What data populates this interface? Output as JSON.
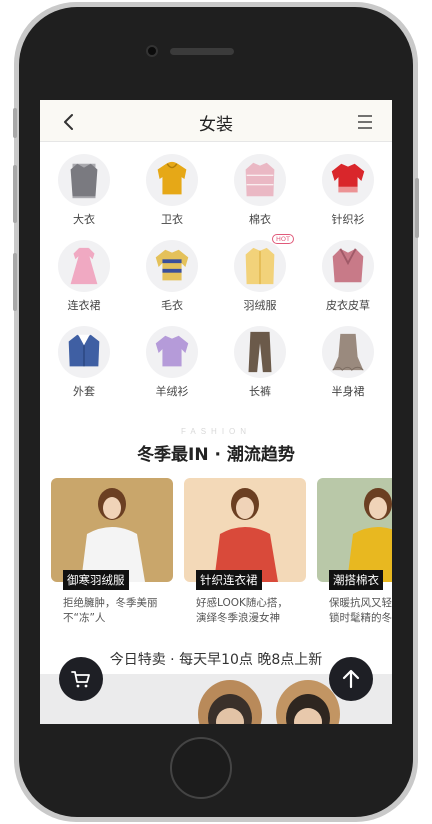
{
  "nav": {
    "title": "女装"
  },
  "categories": [
    {
      "label": "大衣",
      "icon": "coat-icon",
      "color": "#7a7a80"
    },
    {
      "label": "卫衣",
      "icon": "hoodie-icon",
      "color": "#e6a817"
    },
    {
      "label": "棉衣",
      "icon": "padded-jacket-icon",
      "color": "#eab8c4"
    },
    {
      "label": "针织衫",
      "icon": "knit-top-icon",
      "color": "#d9262b"
    },
    {
      "label": "连衣裙",
      "icon": "dress-icon",
      "color": "#f0a9c2"
    },
    {
      "label": "毛衣",
      "icon": "sweater-icon",
      "color": "#e4c15a"
    },
    {
      "label": "羽绒服",
      "icon": "down-jacket-icon",
      "color": "#f2d27a",
      "badge": "HOT"
    },
    {
      "label": "皮衣皮草",
      "icon": "fur-coat-icon",
      "color": "#c87a88"
    },
    {
      "label": "外套",
      "icon": "jacket-icon",
      "color": "#3f5fa3"
    },
    {
      "label": "羊绒衫",
      "icon": "cashmere-icon",
      "color": "#b59bd9"
    },
    {
      "label": "长裤",
      "icon": "trousers-icon",
      "color": "#6b5a4a"
    },
    {
      "label": "半身裙",
      "icon": "skirt-icon",
      "color": "#9a8a7e"
    }
  ],
  "trend": {
    "en": "FASHION",
    "title": "冬季最IN · 潮流趋势",
    "cards": [
      {
        "tag": "御寒羽绒服",
        "desc1": "拒绝臃肿，冬季美丽",
        "desc2": "不“冻”人",
        "bg": "#c9a66b",
        "cloth": "#f4f4f4"
      },
      {
        "tag": "针织连衣裙",
        "desc1": "好感LOOK随心搭，",
        "desc2": "演绎冬季浪漫女神",
        "bg": "#f3d9b8",
        "cloth": "#d94a3a"
      },
      {
        "tag": "潮搭棉衣",
        "desc1": "保暖抗风又轻",
        "desc2": "锁时髦精的冬",
        "bg": "#b9c8a8",
        "cloth": "#e8b820"
      }
    ]
  },
  "special": {
    "text": "今日特卖 · 每天早10点 晚8点上新"
  }
}
